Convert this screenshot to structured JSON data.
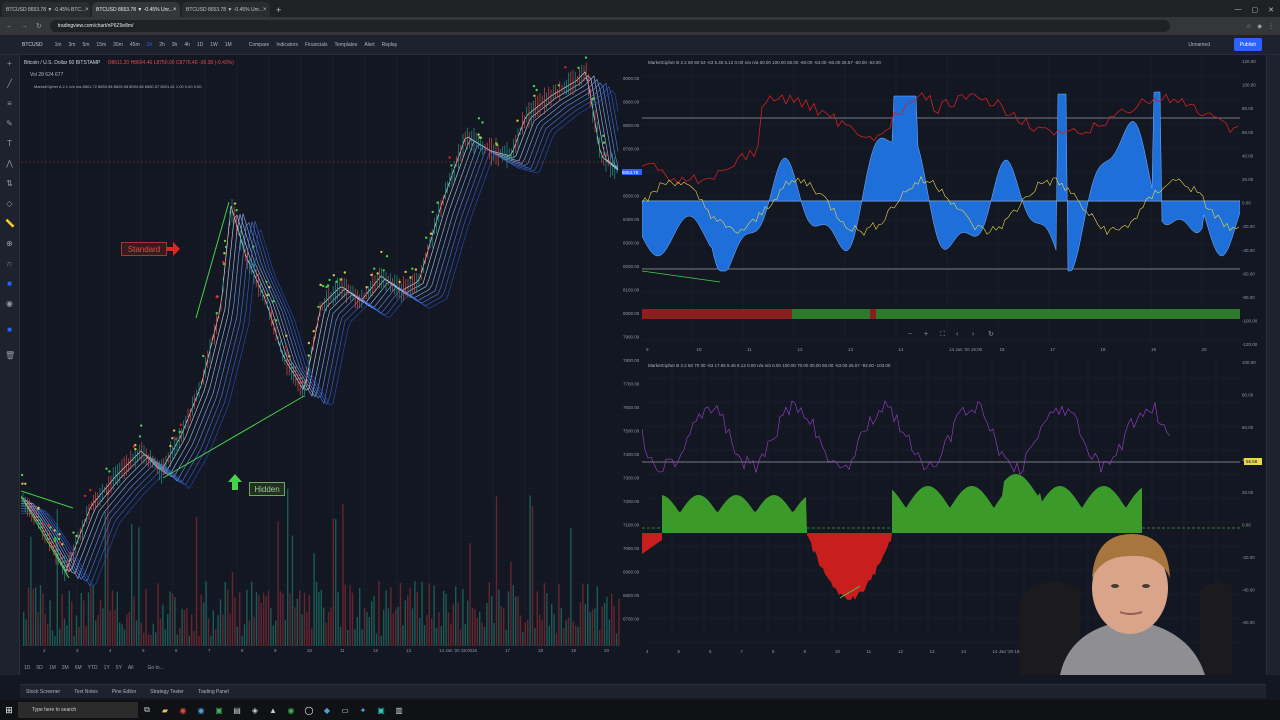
{
  "browser": {
    "tabs": [
      {
        "label": "BTCUSD 8653.78 ▼ -0.45% BTC..."
      },
      {
        "label": "BTCUSD 8653.78 ▼ -0.45% Unr..."
      },
      {
        "label": "BTCUSD 8653.78 ▼ -0.45% Unr..."
      }
    ],
    "url": "tradingview.com/chart/nP6Z9e8m/"
  },
  "toolbar": {
    "symbol": "BTCUSD",
    "intervals": [
      "1m",
      "3m",
      "5m",
      "15m",
      "30m",
      "45m",
      "1h",
      "2h",
      "3h",
      "4h",
      "1D",
      "1W",
      "1M"
    ],
    "compare": "Compare",
    "indicators": "Indicators",
    "financials": "Financials",
    "templates": "Templates",
    "alert": "Alert",
    "replay": "Replay",
    "unnamed": "Unnamed",
    "publish": "Publish"
  },
  "main_chart": {
    "legend_title": "Bitcoin / U.S. Dollar  60  BITSTAMP",
    "legend_ohlc": "O8611.20 H8664.46 L8750.00 C8776.46 -36.38 (-0.43%)",
    "legend_vol": "Vol 28  624  677",
    "legend_mc": "MarketCipher A 2.1  n/a  n/a  8601.72  8653.98  8625.98  8594.58  8560.57  8531.61  1.00  0.00  0.00",
    "standard_label": "Standard",
    "hidden_label": "Hidden",
    "price_ticks": [
      "9000.00",
      "8900.00",
      "8800.00",
      "8700.00",
      "8600.00",
      "8500.00",
      "8400.00",
      "8300.00",
      "8200.00",
      "8100.00",
      "8000.00",
      "7900.00",
      "7800.00",
      "7700.00",
      "7600.00",
      "7500.00",
      "7400.00",
      "7300.00",
      "7200.00",
      "7100.00",
      "7000.00",
      "6900.00",
      "6800.00",
      "6700.00"
    ],
    "time_ticks": [
      "2",
      "3",
      "4",
      "5",
      "6",
      "7",
      "8",
      "9",
      "10",
      "11",
      "12",
      "13",
      "14 Jan '20  19:00",
      "16",
      "17",
      "18",
      "19",
      "20"
    ],
    "current_price": "8653.78"
  },
  "oscillator_top": {
    "legend": "MarketCipher B 2.2  60  60  53  -53  5.45  6.12  0.00  n/a  n/a  60.00  100.00  60.00  -60.00  -53.00  -60.00  26.57  -60.00  -53.00",
    "right_ticks": [
      "120.00",
      "100.00",
      "80.00",
      "60.00",
      "40.00",
      "20.00",
      "0.00",
      "-20.00",
      "-40.00",
      "-60.00",
      "-80.00",
      "-100.00",
      "-120.00"
    ],
    "time_ticks": [
      "9",
      "10",
      "11",
      "12",
      "13",
      "14",
      "14 Jan '20  19:00",
      "16",
      "17",
      "18",
      "19",
      "20"
    ]
  },
  "oscillator_bottom": {
    "legend": "MarketCipher B 2.2  60  70  30  -53  17.65  5.45  6.12  0.00  n/a  n/a  0.00  100.00  70.00  30.00  50.00  -53.00  26.57  -93.00  -103.00",
    "right_ticks": [
      "100.00",
      "80.00",
      "60.00",
      "40.00",
      "20.00",
      "0.00",
      "-20.00",
      "-40.00",
      "-60.00"
    ],
    "marker": "56.58",
    "time_ticks": [
      "4",
      "5",
      "6",
      "7",
      "8",
      "9",
      "10",
      "11",
      "12",
      "13",
      "14",
      "14 Jan '20  19:00"
    ]
  },
  "ranges": [
    "1D",
    "5D",
    "1M",
    "3M",
    "6M",
    "YTD",
    "1Y",
    "5Y",
    "All",
    "Go to..."
  ],
  "bottom_tabs": [
    "Stock Screener",
    "Text Notes",
    "Pine Editor",
    "Strategy Tester",
    "Trading Panel"
  ],
  "taskbar": {
    "search_placeholder": "Type here to search"
  },
  "colors": {
    "bg": "#131722",
    "blue_wave": "#1e6fd9",
    "green_wave": "#3c9a2a",
    "red_wave": "#c81e1e",
    "accent": "#2962ff"
  }
}
